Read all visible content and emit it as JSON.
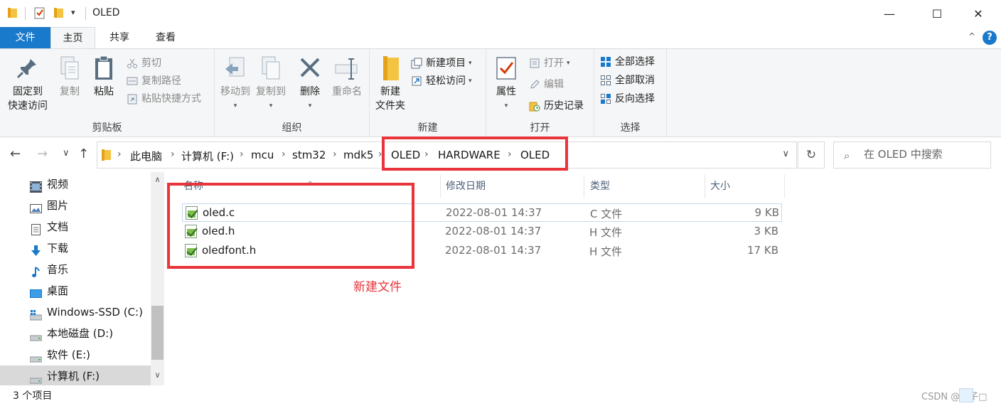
{
  "window": {
    "title": "OLED",
    "minimize": "—",
    "maximize": "☐",
    "close": "✕"
  },
  "quick_access": {
    "dropdown": "▾"
  },
  "tabs": {
    "file": "文件",
    "home": "主页",
    "share": "共享",
    "view": "查看",
    "collapse": "^",
    "help": "?"
  },
  "ribbon": {
    "clipboard": {
      "label": "剪贴板",
      "pin": [
        "固定到",
        "快速访问"
      ],
      "copy": "复制",
      "paste": "粘贴",
      "cut": "剪切",
      "copy_path": "复制路径",
      "paste_shortcut": "粘贴快捷方式"
    },
    "organize": {
      "label": "组织",
      "move_to": "移动到",
      "copy_to": "复制到",
      "delete": "删除",
      "rename": "重命名"
    },
    "new": {
      "label": "新建",
      "new_folder": [
        "新建",
        "文件夹"
      ],
      "new_item": "新建项目",
      "easy_access": "轻松访问"
    },
    "open": {
      "label": "打开",
      "properties": "属性",
      "open": "打开",
      "edit": "编辑",
      "history": "历史记录"
    },
    "select": {
      "label": "选择",
      "select_all": "全部选择",
      "select_none": "全部取消",
      "invert": "反向选择"
    }
  },
  "address": {
    "back": "←",
    "forward": "→",
    "recent": "∨",
    "up": "↑",
    "crumbs": [
      "此电脑",
      "计算机 (F:)",
      "mcu",
      "stm32",
      "mdk5",
      "OLED",
      "HARDWARE",
      "OLED"
    ],
    "separator": "›",
    "dropdown": "∨",
    "refresh": "↻",
    "search_placeholder": "在 OLED 中搜索"
  },
  "nav_pane": {
    "items": [
      {
        "label": "视频",
        "icon": "video-icon"
      },
      {
        "label": "图片",
        "icon": "pictures-icon"
      },
      {
        "label": "文档",
        "icon": "documents-icon"
      },
      {
        "label": "下载",
        "icon": "download-icon"
      },
      {
        "label": "音乐",
        "icon": "music-icon"
      },
      {
        "label": "桌面",
        "icon": "desktop-icon"
      },
      {
        "label": "Windows-SSD (C:)",
        "icon": "windows-drive-icon"
      },
      {
        "label": "本地磁盘 (D:)",
        "icon": "drive-icon"
      },
      {
        "label": "软件 (E:)",
        "icon": "drive-icon"
      },
      {
        "label": "计算机 (F:)",
        "icon": "drive-icon"
      }
    ],
    "selected_index": 9,
    "scroll_up": "∧",
    "scroll_down": "∨"
  },
  "file_list": {
    "sort_indicator": "^",
    "columns": [
      "名称",
      "修改日期",
      "类型",
      "大小"
    ],
    "rows": [
      {
        "name": "oled.c",
        "date": "2022-08-01 14:37",
        "type": "C 文件",
        "size": "9 KB"
      },
      {
        "name": "oled.h",
        "date": "2022-08-01 14:37",
        "type": "H 文件",
        "size": "3 KB"
      },
      {
        "name": "oledfont.h",
        "date": "2022-08-01 14:37",
        "type": "H 文件",
        "size": "17 KB"
      }
    ]
  },
  "annotation": {
    "text": "新建文件",
    "color": "#e8343a"
  },
  "status": {
    "count": "3 个项目",
    "watermark": "CSDN @橙子□"
  },
  "colors": {
    "accent": "#1979ca",
    "ribbon_bg": "#f5f6f7",
    "annotation": "#e8343a"
  }
}
